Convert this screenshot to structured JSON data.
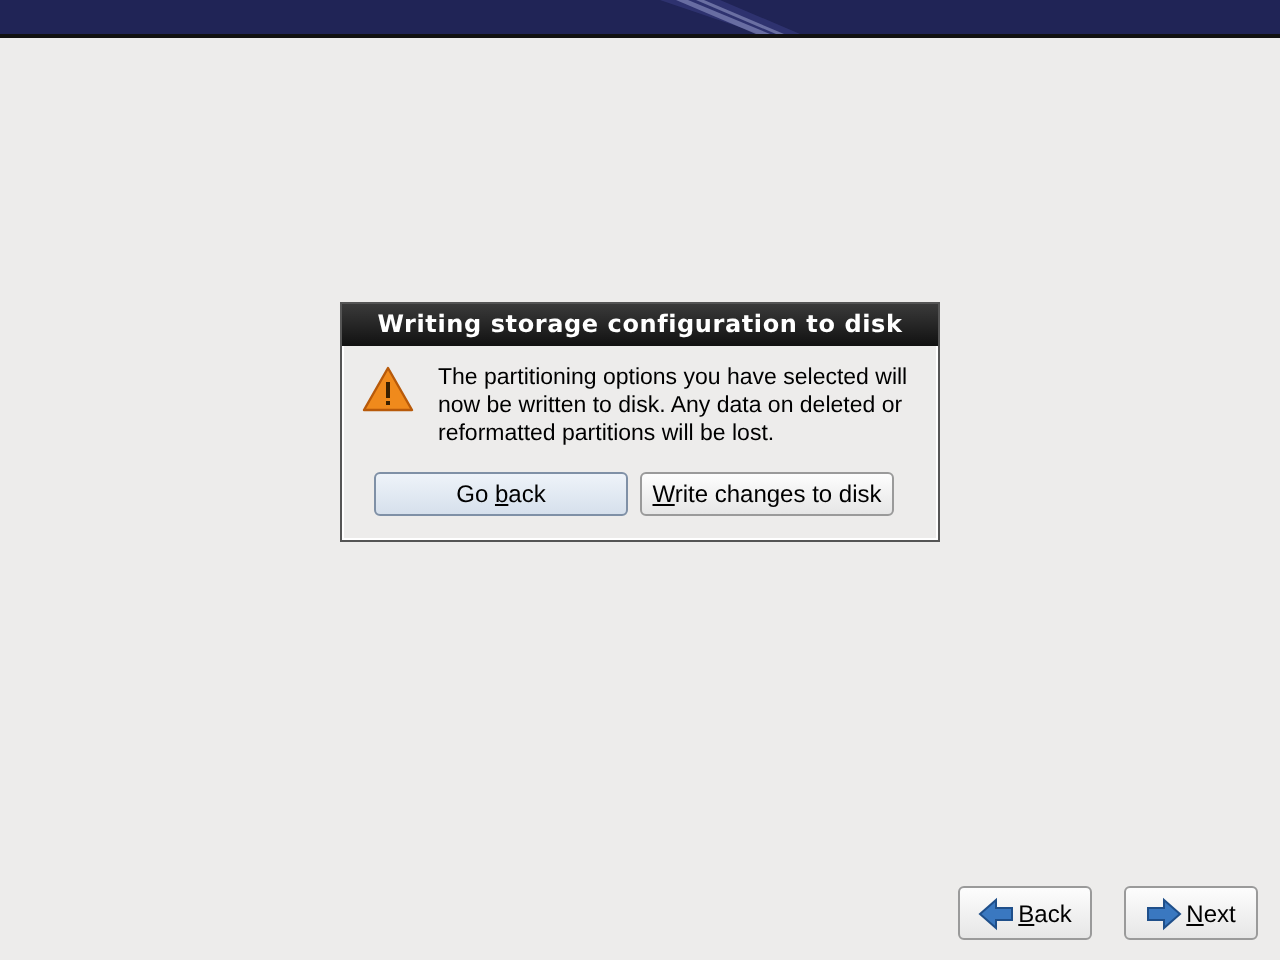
{
  "dialog": {
    "title": "Writing storage configuration to disk",
    "message": "The partitioning options you have selected will now be written to disk.  Any data on deleted or reformatted partitions will be lost.",
    "buttons": [
      {
        "label": {
          "before": "Go ",
          "key": "b",
          "after": "ack"
        },
        "kind": "default"
      },
      {
        "label": {
          "key": "W",
          "after": "rite changes to disk"
        },
        "kind": "normal"
      }
    ]
  },
  "nav_buttons": [
    {
      "label": {
        "key": "B",
        "after": "ack"
      },
      "kind": "back"
    },
    {
      "label": {
        "key": "N",
        "after": "ext"
      },
      "kind": "next"
    }
  ]
}
